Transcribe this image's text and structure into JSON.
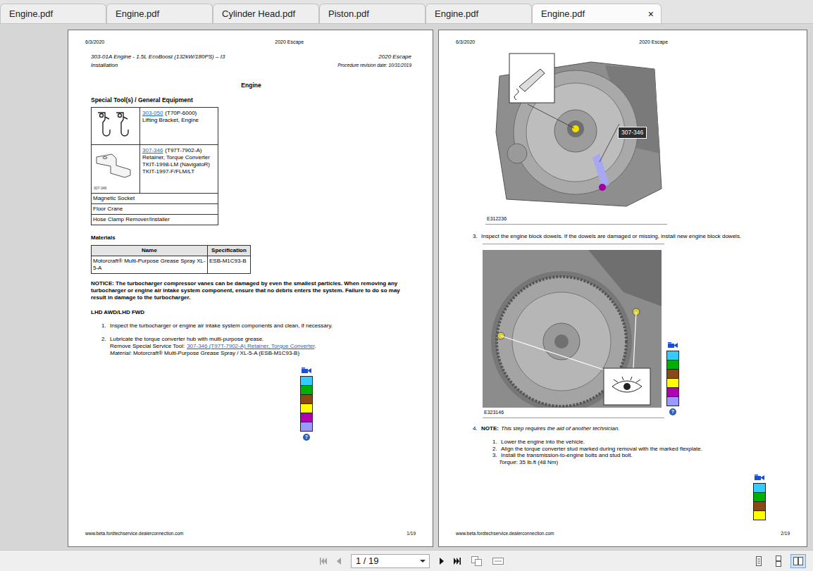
{
  "tabs": [
    {
      "label": "Engine.pdf",
      "selected": false
    },
    {
      "label": "Engine.pdf",
      "selected": false
    },
    {
      "label": "Cylinder Head.pdf",
      "selected": false
    },
    {
      "label": "Piston.pdf",
      "selected": false
    },
    {
      "label": "Engine.pdf",
      "selected": false
    },
    {
      "label": "Engine.pdf",
      "selected": true,
      "close": "×"
    }
  ],
  "page_left": {
    "header": {
      "date": "6/3/2020",
      "model": "2020 Escape"
    },
    "title": "303-01A Engine - 1.5L EcoBoost (132kW/180PS) – I3",
    "title_right": "2020 Escape",
    "subtitle": "Installation",
    "revision": "Procedure revision date: 10/31/2019",
    "section": "Engine",
    "tools_heading": "Special Tool(s) / General Equipment",
    "tools": [
      {
        "kind": "bracket",
        "link": "303-050",
        "code": "(T70P-6000)",
        "lines": [
          "Lifting Bracket, Engine"
        ]
      },
      {
        "kind": "retainer",
        "link": "307-346",
        "code": "(T97T-7902-A)",
        "lines": [
          "Retainer, Torque Converter",
          "TKIT-1998-LM (NavigatoR)",
          "TKIT-1997-F/FLM/LT"
        ],
        "image_label": "307-346"
      },
      {
        "kind": "text",
        "name": "Magnetic Socket"
      },
      {
        "kind": "text",
        "name": "Floor Crane"
      },
      {
        "kind": "text",
        "name": "Hose Clamp Remover/Installer"
      }
    ],
    "materials_heading": "Materials",
    "materials_columns": [
      "Name",
      "Specification"
    ],
    "materials": [
      [
        "Motorcraft® Multi-Purpose Grease Spray XL-5-A",
        "ESB-M1C93-B"
      ]
    ],
    "notice": "NOTICE: The turbocharger compressor vanes can be damaged by even the smallest particles. When removing any turbocharger or engine air intake system component, ensure that no debris enters the system. Failure to do so may result in damage to the turbocharger.",
    "variant": "LHD AWD/LHD FWD",
    "step1": {
      "number": "1.",
      "text": "Inspect the turbocharger or engine air intake system components and clean, if necessary."
    },
    "step2": {
      "number": "2.",
      "text": "Lubricate the torque converter hub with multi-purpose grease.",
      "tool_prefix": "Remove Special Service Tool:",
      "tool_link": "307-346 (T97T-7902-A) Retainer, Torque Converter",
      "tool_suffix": ".",
      "material_label": "Material",
      "material": ": Motorcraft® Multi-Purpose Grease Spray / XL-5-A (ESB-M1C93-B)"
    },
    "palette": {
      "swatches": [
        {
          "color": "#33ccff"
        },
        {
          "color": "#00b000"
        },
        {
          "color": "#8b4a14"
        },
        {
          "color": "#ffff00"
        },
        {
          "color": "#b000b0"
        },
        {
          "color": "#9999ff"
        }
      ],
      "help": "?"
    },
    "footer": {
      "url": "www.beta.fordtechservice.dealerconnection.com",
      "page": "1/19"
    }
  },
  "page_right": {
    "header": {
      "date": "6/3/2020",
      "model": "2020 Escape"
    },
    "figure1": {
      "kind": "transmission",
      "label": "E312236",
      "callout": "307-346"
    },
    "step3": {
      "number": "3.",
      "text": "Inspect the engine block dowels. If the dowels are damaged or missing, install new engine block dowels."
    },
    "figure2": {
      "kind": "flywheel",
      "label": "E323146"
    },
    "palette2": {
      "swatches": [
        {
          "color": "#33ccff"
        },
        {
          "color": "#00b000"
        },
        {
          "color": "#8b4a14"
        },
        {
          "color": "#ffff00"
        },
        {
          "color": "#b000b0"
        },
        {
          "color": "#9999ff"
        }
      ],
      "help": "?"
    },
    "step4": {
      "number": "4.",
      "note_label": "NOTE:",
      "note": "This step requires the aid of another technician.",
      "substeps": [
        {
          "number": "1.",
          "text": "Lower the engine into the vehicle."
        },
        {
          "number": "2.",
          "text": "Align the torque converter stud marked during removal with the marked flexplate."
        },
        {
          "number": "3.",
          "text": "Install the transmission-to-engine bolts and stud bolt."
        }
      ],
      "torque_label": "Torque",
      "torque": ": 35 lb.ft (48 Nm)"
    },
    "palette3": {
      "swatches": [
        {
          "color": "#33ccff"
        },
        {
          "color": "#00b000"
        },
        {
          "color": "#8b4a14"
        },
        {
          "color": "#ffff00"
        }
      ]
    },
    "footer": {
      "url": "www.beta.fordtechservice.dealerconnection.com",
      "page": "2/19"
    }
  },
  "toolbar": {
    "nav_back": [
      {
        "kind": "first",
        "disabled": true
      },
      {
        "kind": "prev",
        "disabled": true
      }
    ],
    "page_field": "1 / 19",
    "nav_forward": [
      {
        "kind": "next",
        "disabled": false
      },
      {
        "kind": "last",
        "disabled": false
      }
    ],
    "tools": [
      {
        "kind": "fit-page"
      },
      {
        "kind": "fit-width"
      }
    ],
    "view_modes": [
      {
        "kind": "single",
        "selected": false
      },
      {
        "kind": "continuous",
        "selected": false
      },
      {
        "kind": "facing",
        "selected": true
      }
    ]
  }
}
